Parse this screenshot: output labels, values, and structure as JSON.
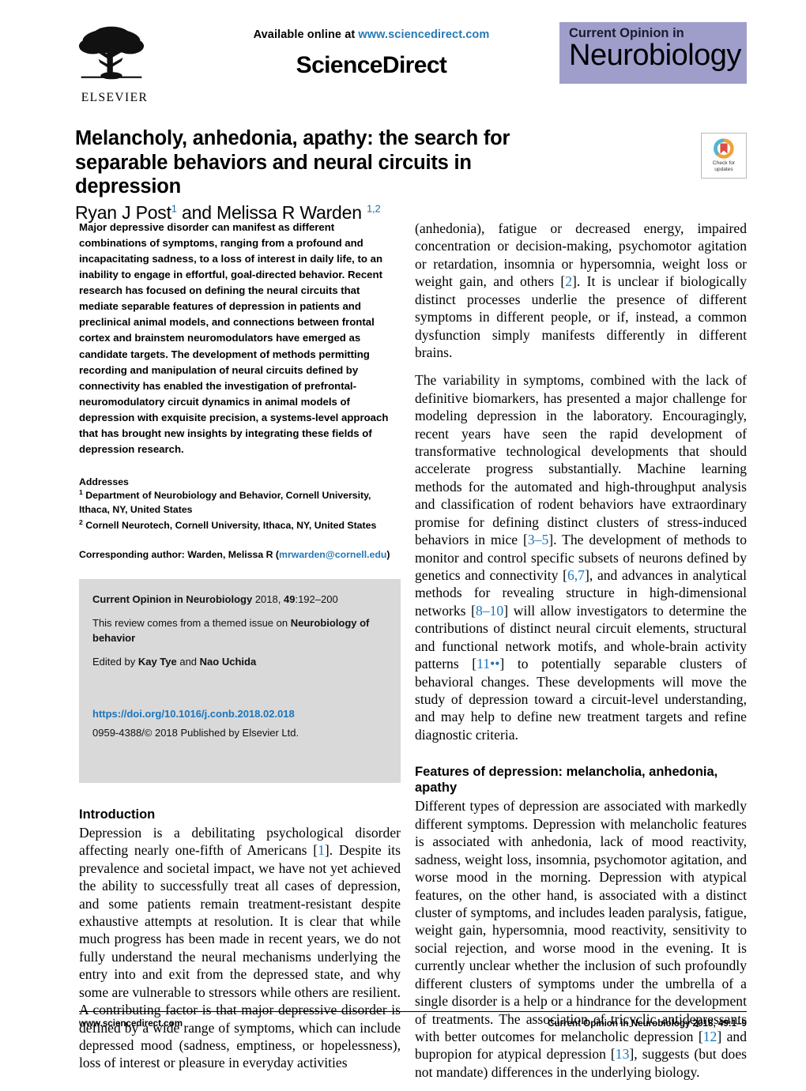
{
  "masthead": {
    "available_prefix": "Available online at ",
    "available_url": "www.sciencedirect.com",
    "sciencedirect": "ScienceDirect",
    "publisher": "ELSEVIER",
    "journal_line1": "Current Opinion in",
    "journal_line2": "Neurobiology"
  },
  "article": {
    "title": "Melancholy, anhedonia, apathy: the search for separable behaviors and neural circuits in depression",
    "authors_part1": "Ryan J Post",
    "authors_sup1": "1",
    "authors_joiner": " and ",
    "authors_part2": "Melissa R Warden ",
    "authors_sup2": "1,2"
  },
  "crossmark": {
    "line1": "Check for",
    "line2": "updates",
    "ring_color": "#f0a23c",
    "flag_color": "#d94f45",
    "arc_color": "#4db8d4"
  },
  "abstract": {
    "text": "Major depressive disorder can manifest as different combinations of symptoms, ranging from a profound and incapacitating sadness, to a loss of interest in daily life, to an inability to engage in effortful, goal-directed behavior. Recent research has focused on defining the neural circuits that mediate separable features of depression in patients and preclinical animal models, and connections between frontal cortex and brainstem neuromodulators have emerged as candidate targets. The development of methods permitting recording and manipulation of neural circuits defined by connectivity has enabled the investigation of prefrontal-neuromodulatory circuit dynamics in animal models of depression with exquisite precision, a systems-level approach that has brought new insights by integrating these fields of depression research."
  },
  "addresses": {
    "heading": "Addresses",
    "aff1_sup": "1",
    "aff1": " Department of Neurobiology and Behavior, Cornell University, Ithaca, NY, United States",
    "aff2_sup": "2",
    "aff2": " Cornell Neurotech, Cornell University, Ithaca, NY, United States",
    "corresponding_prefix": "Corresponding author: Warden, Melissa R (",
    "corresponding_email": "mrwarden@cornell.edu",
    "corresponding_suffix": ")"
  },
  "journal_box": {
    "citation_bold": "Current Opinion in Neurobiology",
    "citation_rest": " 2018, ",
    "citation_volume": "49",
    "citation_pages": ":192–200",
    "themed_prefix": "This review comes from a themed issue on ",
    "themed_bold": "Neurobiology of behavior",
    "edited_prefix": "Edited by ",
    "editor1": "Kay Tye",
    "edited_joiner": " and ",
    "editor2": "Nao Uchida",
    "doi": "https://doi.org/10.1016/j.conb.2018.02.018",
    "issn_line": "0959-4388/© 2018 Published by Elsevier Ltd."
  },
  "sections": {
    "introduction_heading": "Introduction",
    "features_heading": "Features of depression: melancholia, anhedonia, apathy"
  },
  "body": {
    "intro_p1_a": "Depression is a debilitating psychological disorder affecting nearly one-fifth of Americans [",
    "intro_p1_cite1": "1",
    "intro_p1_b": "]. Despite its prevalence and societal impact, we have not yet achieved the ability to successfully treat all cases of depression, and some patients remain treatment-resistant despite exhaustive attempts at resolution. It is clear that while much progress has been made in recent years, we do not fully understand the neural mechanisms underlying the entry into and exit from the depressed state, and why some are vulnerable to stressors while others are resilient. A contributing factor is that major depressive disorder is defined by a wide range of symptoms, which can include depressed mood (sadness, emptiness, or hopelessness), loss of interest or pleasure in everyday activities",
    "right_p1_a": "(anhedonia), fatigue or decreased energy, impaired concentration or decision-making, psychomotor agitation or retardation, insomnia or hypersomnia, weight loss or weight gain, and others [",
    "right_p1_cite": "2",
    "right_p1_b": "]. It is unclear if biologically distinct processes underlie the presence of different symptoms in different people, or if, instead, a common dysfunction simply manifests differently in different brains.",
    "right_p2_a": "The variability in symptoms, combined with the lack of definitive biomarkers, has presented a major challenge for modeling depression in the laboratory. Encouragingly, recent years have seen the rapid development of transformative technological developments that should accelerate progress substantially. Machine learning methods for the automated and high-throughput analysis and classification of rodent behaviors have extraordinary promise for defining distinct clusters of stress-induced behaviors in mice [",
    "right_p2_cite1": "3–5",
    "right_p2_b": "]. The development of methods to monitor and control specific subsets of neurons defined by genetics and connectivity [",
    "right_p2_cite2": "6,7",
    "right_p2_c": "], and advances in analytical methods for revealing structure in high-dimensional networks [",
    "right_p2_cite3": "8–10",
    "right_p2_d": "] will allow investigators to determine the contributions of distinct neural circuit elements, structural and functional network motifs, and whole-brain activity patterns [",
    "right_p2_cite4": "11••",
    "right_p2_e": "] to potentially separable clusters of behavioral changes. These developments will move the study of depression toward a circuit-level understanding, and may help to define new treatment targets and refine diagnostic criteria.",
    "right_p3_a": "Different types of depression are associated with markedly different symptoms. Depression with melancholic features is associated with anhedonia, lack of mood reactivity, sadness, weight loss, insomnia, psychomotor agitation, and worse mood in the morning. Depression with atypical features, on the other hand, is associated with a distinct cluster of symptoms, and includes leaden paralysis, fatigue, weight gain, hypersomnia, mood reactivity, sensitivity to social rejection, and worse mood in the evening. It is currently unclear whether the inclusion of such profoundly different clusters of symptoms under the umbrella of a single disorder is a help or a hindrance for the development of treatments. The association of tricyclic antidepressants with better outcomes for melancholic depression [",
    "right_p3_cite1": "12",
    "right_p3_b": "] and bupropion for atypical depression [",
    "right_p3_cite2": "13",
    "right_p3_c": "], suggests (but does not mandate) differences in the underlying biology."
  },
  "footer": {
    "left": "www.sciencedirect.com",
    "right": "Current Opinion in Neurobiology 2018, 49:1–9"
  }
}
